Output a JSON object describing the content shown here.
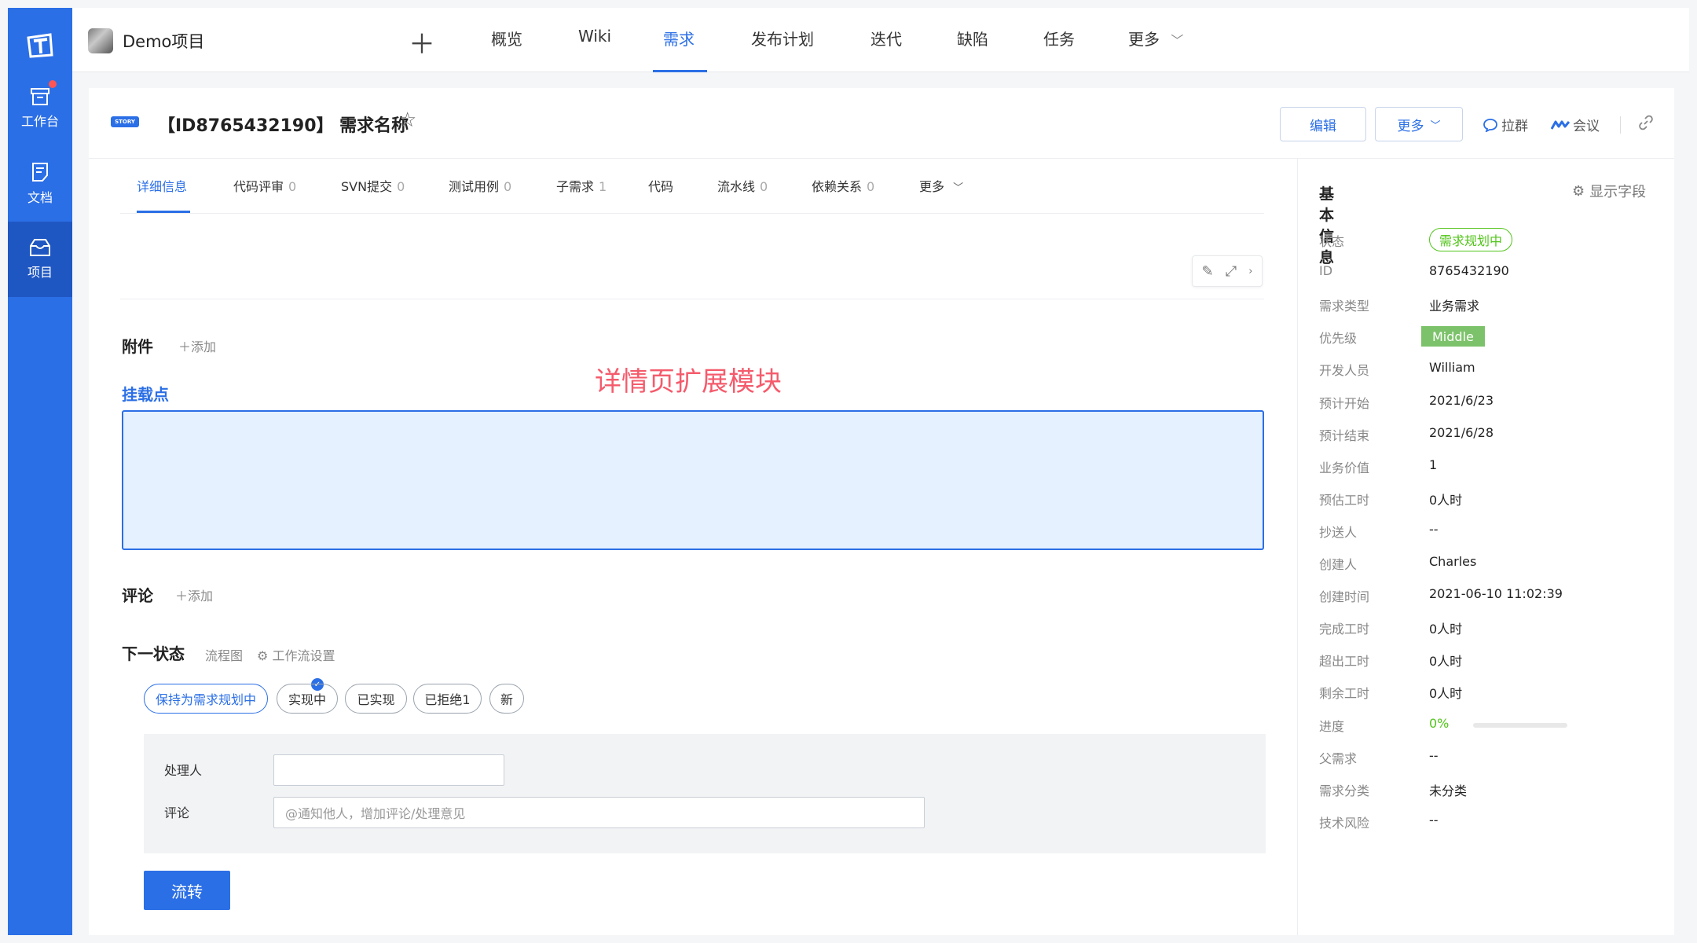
{
  "leftnav": {
    "items": [
      {
        "label": "工作台",
        "icon": "workbench-icon"
      },
      {
        "label": "文档",
        "icon": "document-icon"
      },
      {
        "label": "项目",
        "icon": "project-icon"
      }
    ]
  },
  "topbar": {
    "project_name": "Demo项目",
    "nav": [
      "概览",
      "Wiki",
      "需求",
      "发布计划",
      "迭代",
      "缺陷",
      "任务",
      "更多"
    ],
    "active": "需求"
  },
  "header": {
    "tag": "STORY",
    "title": "【ID8765432190】 需求名称",
    "edit_label": "编辑",
    "more_label": "更多",
    "group_label": "拉群",
    "meeting_label": "会议"
  },
  "tabs": [
    {
      "label": "详细信息",
      "count": ""
    },
    {
      "label": "代码评审",
      "count": "0"
    },
    {
      "label": "SVN提交",
      "count": "0"
    },
    {
      "label": "测试用例",
      "count": "0"
    },
    {
      "label": "子需求",
      "count": "1"
    },
    {
      "label": "代码",
      "count": ""
    },
    {
      "label": "流水线",
      "count": "0"
    },
    {
      "label": "依赖关系",
      "count": "0"
    },
    {
      "label": "更多",
      "count": ""
    }
  ],
  "attachments": {
    "title": "附件",
    "add_label": "添加"
  },
  "mount": {
    "label": "挂载点",
    "extension_label": "详情页扩展模块"
  },
  "comments": {
    "title": "评论",
    "add_label": "添加"
  },
  "next_state": {
    "title": "下一状态",
    "flowchart_label": "流程图",
    "workflow_label": "工作流设置",
    "options": [
      "保持为需求规划中",
      "实现中",
      "已实现",
      "已拒绝1",
      "新"
    ],
    "selected": "保持为需求规划中"
  },
  "form": {
    "assignee_label": "处理人",
    "assignee_value": "",
    "comment_label": "评论",
    "comment_placeholder": "@通知他人，增加评论/处理意见",
    "submit_label": "流转"
  },
  "panel": {
    "title": "基本信息",
    "show_fields_label": "显示字段",
    "fields": [
      {
        "key": "状态",
        "value": "需求规划中",
        "kind": "status"
      },
      {
        "key": "ID",
        "value": "8765432190"
      },
      {
        "key": "需求类型",
        "value": "业务需求"
      },
      {
        "key": "优先级",
        "value": "Middle",
        "kind": "priority"
      },
      {
        "key": "开发人员",
        "value": "William"
      },
      {
        "key": "预计开始",
        "value": "2021/6/23"
      },
      {
        "key": "预计结束",
        "value": "2021/6/28"
      },
      {
        "key": "业务价值",
        "value": "1"
      },
      {
        "key": "预估工时",
        "value": "0人时"
      },
      {
        "key": "抄送人",
        "value": "--"
      },
      {
        "key": "创建人",
        "value": "Charles"
      },
      {
        "key": "创建时间",
        "value": "2021-06-10 11:02:39"
      },
      {
        "key": "完成工时",
        "value": "0人时"
      },
      {
        "key": "超出工时",
        "value": "0人时"
      },
      {
        "key": "剩余工时",
        "value": "0人时"
      },
      {
        "key": "进度",
        "value": "0%",
        "kind": "progress",
        "progress": 0
      },
      {
        "key": "父需求",
        "value": "--"
      },
      {
        "key": "需求分类",
        "value": "未分类"
      },
      {
        "key": "技术风险",
        "value": "--"
      }
    ]
  },
  "colors": {
    "primary": "#2b6fe6",
    "success": "#52c41a",
    "highlight": "#f45b6c",
    "priority": "#7cc26b"
  }
}
